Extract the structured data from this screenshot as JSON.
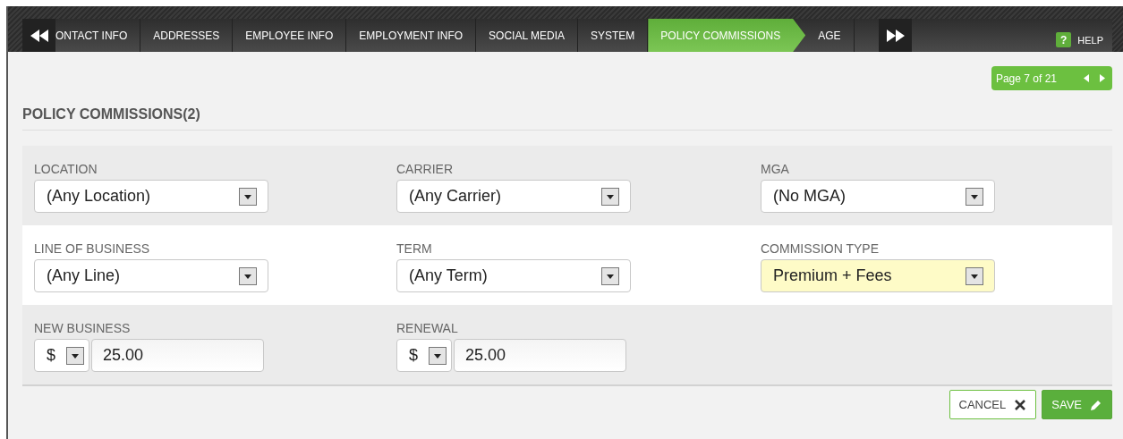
{
  "tabs": [
    {
      "label": "ONTACT INFO",
      "selected": false
    },
    {
      "label": "ADDRESSES",
      "selected": false
    },
    {
      "label": "EMPLOYEE INFO",
      "selected": false
    },
    {
      "label": "EMPLOYMENT INFO",
      "selected": false
    },
    {
      "label": "SOCIAL MEDIA",
      "selected": false
    },
    {
      "label": "SYSTEM",
      "selected": false
    },
    {
      "label": "POLICY COMMISSIONS",
      "selected": true
    },
    {
      "label": "AGE",
      "selected": false
    }
  ],
  "help": {
    "icon": "?",
    "label": "HELP"
  },
  "pager": {
    "label": "Page 7 of 21"
  },
  "section_title": "POLICY COMMISSIONS(2)",
  "rows": [
    {
      "fields": [
        {
          "kind": "select",
          "label": "LOCATION",
          "value": "(Any Location)",
          "highlighted": false
        },
        {
          "kind": "select",
          "label": "CARRIER",
          "value": "(Any Carrier)",
          "highlighted": false
        },
        {
          "kind": "select",
          "label": "MGA",
          "value": "(No MGA)",
          "highlighted": false
        }
      ]
    },
    {
      "fields": [
        {
          "kind": "select",
          "label": "LINE OF BUSINESS",
          "value": "(Any Line)",
          "highlighted": false
        },
        {
          "kind": "select",
          "label": "TERM",
          "value": "(Any Term)",
          "highlighted": false
        },
        {
          "kind": "select",
          "label": "COMMISSION TYPE",
          "value": "Premium + Fees",
          "highlighted": true
        }
      ]
    },
    {
      "fields": [
        {
          "kind": "amount",
          "label": "NEW BUSINESS",
          "unit": "$",
          "value": "25.00",
          "highlighted": false
        },
        {
          "kind": "amount",
          "label": "RENEWAL",
          "unit": "$",
          "value": "25.00",
          "highlighted": false
        }
      ]
    }
  ],
  "buttons": [
    {
      "kind": "cancel",
      "label": "CANCEL"
    },
    {
      "kind": "save",
      "label": "SAVE"
    }
  ]
}
